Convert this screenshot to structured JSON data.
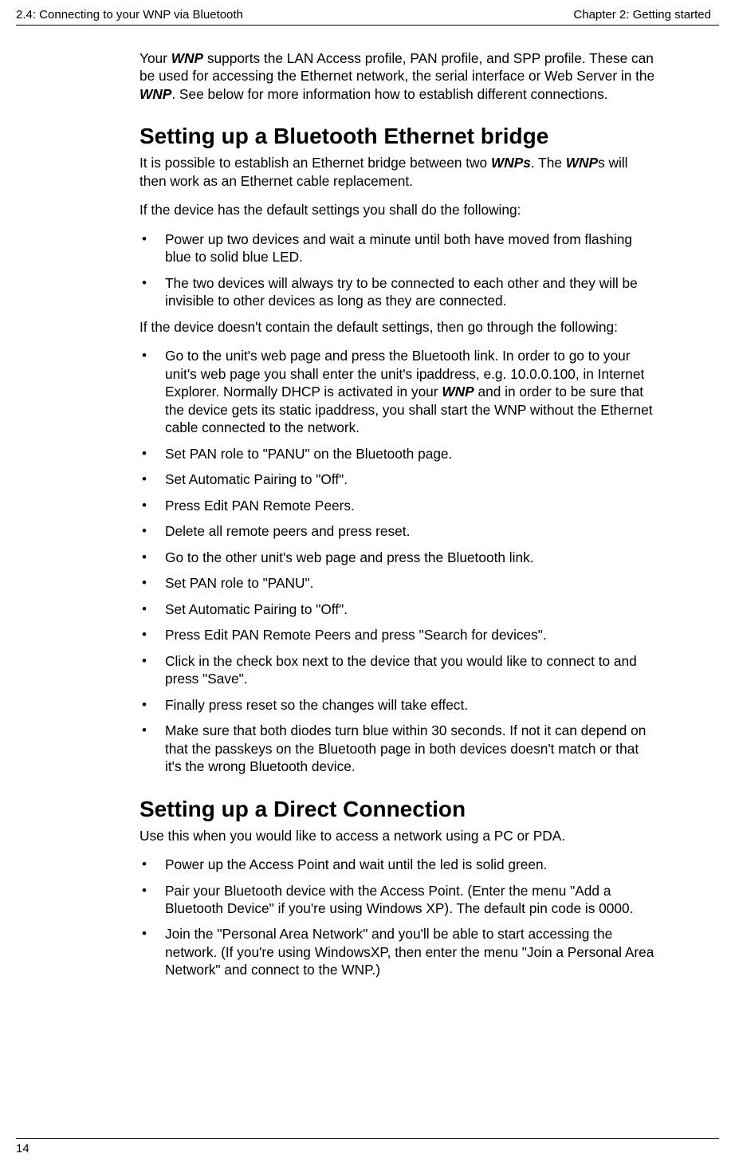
{
  "header": {
    "left": "2.4: Connecting to your WNP via Bluetooth",
    "right": "Chapter 2: Getting started"
  },
  "intro": {
    "pre1": "Your ",
    "wnp1": "WNP",
    "mid1": " supports the LAN Access profile, PAN profile, and SPP profile. These can be used for accessing the Ethernet network, the serial interface or Web Server in the ",
    "wnp2": "WNP",
    "post1": ". See below for more information how to establish different connections."
  },
  "section1": {
    "heading": "Setting up a Bluetooth Ethernet bridge",
    "p1a": "It is possible to establish an Ethernet bridge between two ",
    "p1b": "WNPs",
    "p1c": ". The ",
    "p1d": "WNP",
    "p1e": "s will then work as an Ethernet cable replacement.",
    "p2": "If the device has the default settings you shall do the following:",
    "list1": {
      "i0": "Power up two devices and wait a minute until both have moved from flashing blue to solid blue LED.",
      "i1": "The two devices will always try to be connected to each other and they will be invisible to other devices as long as they are connected."
    },
    "p3": "If the device doesn't contain the default settings, then go through the following:",
    "list2": {
      "i0a": "Go to the unit's web page and press the Bluetooth link. In order to go to your unit's web page you shall enter the unit's ipaddress, e.g. 10.0.0.100, in Internet Explorer. Normally DHCP is activated in your ",
      "i0b": "WNP",
      "i0c": " and in order to be sure that the device gets its static ipaddress, you shall start the WNP without the Ethernet cable connected to the network.",
      "i1": "Set PAN role to \"PANU\" on the Bluetooth page.",
      "i2": "Set Automatic Pairing to \"Off\".",
      "i3": "Press Edit PAN Remote Peers.",
      "i4": "Delete all remote peers and press reset.",
      "i5": "Go to the other unit's web page and press the Bluetooth link.",
      "i6": "Set PAN role to \"PANU\".",
      "i7": "Set Automatic Pairing to \"Off\".",
      "i8": "Press Edit PAN Remote Peers and press \"Search for devices\".",
      "i9": "Click in the check box next to the device that you would like to connect to and press \"Save\".",
      "i10": "Finally press reset so the changes will take effect.",
      "i11": "Make sure that both diodes turn blue within 30 seconds. If not it can depend on that the passkeys on the Bluetooth page in both devices doesn't match or that it's the wrong Bluetooth device."
    }
  },
  "section2": {
    "heading": "Setting up a Direct Connection",
    "p1": "Use this when you would like to access a network using a PC or PDA.",
    "list": {
      "i0": "Power up the Access Point and wait until the led is solid green.",
      "i1": "Pair your Bluetooth device with the Access Point. (Enter the menu \"Add a Bluetooth Device\" if you're using Windows XP). The default pin code is 0000.",
      "i2": "Join the \"Personal Area Network\" and you'll be able to start accessing the network. (If you're using WindowsXP, then enter the menu \"Join a Personal Area Network\" and connect to the WNP.)"
    }
  },
  "footer": {
    "pagenum": "14"
  }
}
